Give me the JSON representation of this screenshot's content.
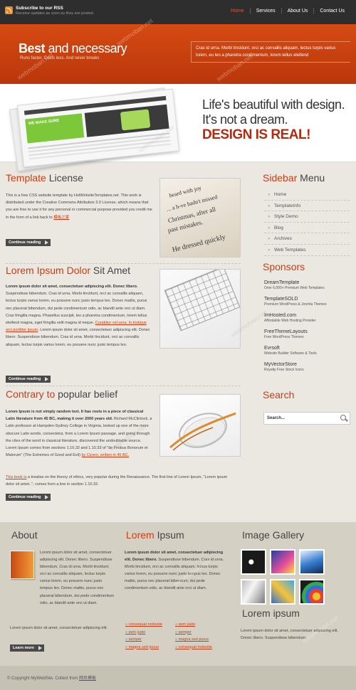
{
  "topbar": {
    "rss_title": "Subscribe to our RSS",
    "rss_subtitle": "Receive updates as soon as they are posted.",
    "nav": [
      "Home",
      "Services",
      "About Us",
      "Contact Us"
    ]
  },
  "header": {
    "title_bold": "Best",
    "title_rest": " and necessary",
    "tagline": "Runs faster. Costs less. And never breaks",
    "text": "Cras id urna. Morbi tincidunt, orci ac convallis aliquam, lectus turpis varius lorem, eu leo a pharetra condimentum, lorem tellus eleifend"
  },
  "banner": {
    "mock_label": "WE MAKE SURE",
    "line1": "Life's beautiful with design.",
    "line2": "It's not a dream.",
    "line3": "DESIGN IS REAL!"
  },
  "posts": [
    {
      "title_hi": "Template",
      "title_rest": " License",
      "text_a": "This is a free CSS website template by HotWebsiteTemplates.net. This work is distributed under the Creative Commons Attribution 3.0 License, which means that you are free to use it for any personal or commercial purpose provided you credit me in the form of a link back to ",
      "link": "模板之家",
      "button": "Continue reading"
    },
    {
      "title_hi": "Lorem Ipsum Dolor",
      "title_rest": " Sit Amet",
      "strong": "Lorem ipsum dolor sit amet, consectetuer adipiscing elit. Donec libero.",
      "text_a": " Suspendisse bibendum. Cras id urna. Morbi tincidunt, orci ac convallis aliquam, lectus turpis varius lorem, eu posuere nunc justo tempus leo. Donec mattis, purus nec placerat bibendum, dui pede condimentum odio, ac blandit ante orci ut diam. Cras fringilla magna. Phasellus suscipit, leo a pharetra condimentum, lorem tellus eleifend magna, eget fringilla velit magna id neque. ",
      "link": "Curabitur vel urna. In tristique orci porttitor ipsum",
      "text_b": ". Lorem ipsum dolor sit amet, consectetuer adipiscing elit. Donec libero. Suspendisse bibendum. Cras id urna. Morbi tincidunt, orci ac convallis aliquam, lectus turpis varius lorem, eu posuere nunc justo tempus leo.",
      "button": "Continue reading"
    },
    {
      "title_hi": "Contrary to",
      "title_rest": " popular belief",
      "strong": "Lorem Ipsum is not simply random text. It has roots in a piece of classical Latin literature from 45 BC, making it over 2000 years old.",
      "text_a": " Richard McClintock, a Latin professor at Hampden-Sydney College in Virginia, looked up one of the more obscure Latin words, consectetur, from a Lorem Ipsum passage, and going through the cites of the word in classical literature, discovered the undoubtable source. Lorem Ipsum comes from sections 1.10.32 and 1.10.33 of \"de Finibus Bonorum et Malorum\" (The Extremes of Good and Evil) ",
      "link": "by Cicero, written in 45 BC.",
      "link2": "This book is",
      "text_b": " a treatise on the theory of ethics, very popular during the Renaissance. The first line of Lorem Ipsum, \"Lorem ipsum dolor sit amet..\", comes from a line in section 1.10.32.",
      "button": "Continue reading"
    }
  ],
  "book_words": [
    "heard with joy",
    "... a h-ve hadn't missed",
    "Christmas, after all",
    "past mistakes.",
    "He dressed quickly"
  ],
  "sidebar": {
    "menu_hi": "Sidebar",
    "menu_rest": " Menu",
    "menu": [
      "Home",
      "TemplateInfo",
      "Style Demo",
      "Blog",
      "Archives",
      "Web Templates"
    ],
    "sponsors_title": "Sponsors",
    "sponsors": [
      {
        "name": "DreamTemplate",
        "desc": "Over 6,000+ Premium Web Templates"
      },
      {
        "name": "TemplateSOLD",
        "desc": "Premium WordPress & Joomla Themes"
      },
      {
        "name": "ImHosted.com",
        "desc": "Affordable Web Hosting Provider"
      },
      {
        "name": "FreeThemeLayouts",
        "desc": "Free WordPress Themes"
      },
      {
        "name": "Evrsoft",
        "desc": "Website Builder Software & Tools"
      },
      {
        "name": "MyVectorStore",
        "desc": "Royalty Free Stock Icons"
      }
    ],
    "search_title": "Search",
    "search_placeholder": "Search..."
  },
  "bottom": {
    "about_title": "About",
    "about_text": "Lorem ipsum dolor sit amet, consectetuer adipiscing elit. Donec libero. Suspendisse bibendum. Cras id urna. Morbi tincidunt, orci ac convallis aliquam, lectus turpis varius lorem, eu posuere nunc justo tempus leo. Donec mattis, purus nec placerat bibendum, dui pede condimentum odio, ac blandit ante orci ut diam.",
    "about_text2": "Lorem ipsum dolor sit amet, consectetuer adipiscing elit.",
    "about_button": "Learn more",
    "lorem_title_hi": "Lorem",
    "lorem_title_rest": " Ipsum",
    "lorem_strong": "Lorem ipsum dolor sit amet, consectetuer adipiscing elit. Donec libero.",
    "lorem_text": " Suspendisse bibendum. Cras id urna. Morbi tincidunt, orci ac convallis aliquam, lectus turpis varius lorem, eu posuere nunc justo tempus leo. Donec mattis, purus nec placerat bibendum, dui pede condimentum odio, ac blandit ante orci ut diam.",
    "links": [
      "consequat molestie",
      "sem justo",
      "sem justo",
      "semper",
      "semper",
      "magna sed purus",
      "magna sed purus",
      "consequat molestie"
    ],
    "gallery_title": "Image Gallery",
    "gallery_sub": "Lorem ipsum",
    "gallery_text": "Lorem ipsum dolor sit amet, consectetuer adipiscing elit. Donec libero. Suspendisse bibendum."
  },
  "footer": {
    "text": "© Copyright MyWebSite. Collect from ",
    "link": "网页模板"
  },
  "watermark": "webmoban.net",
  "colors": {
    "accent": "#c93d15",
    "header": "#d64a12",
    "topbar": "#2e2e2e",
    "page": "#eae8e0",
    "bottom": "#d4d1c4"
  }
}
